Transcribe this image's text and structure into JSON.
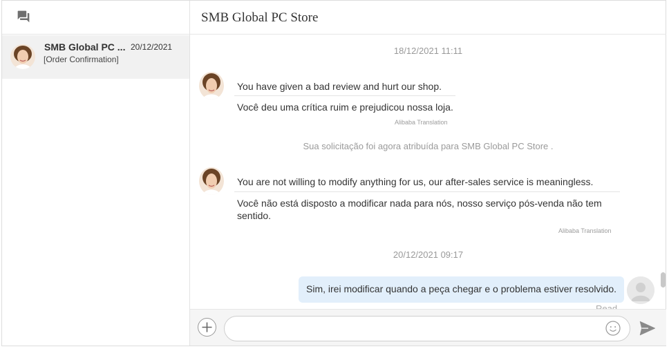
{
  "sidebar": {
    "conversations": [
      {
        "name": "SMB Global PC ...",
        "date": "20/12/2021",
        "preview": "[Order Confirmation]"
      }
    ]
  },
  "chat": {
    "title": "SMB Global PC Store",
    "timestamps": [
      "18/12/2021 11:11",
      "20/12/2021 09:17"
    ],
    "messages": [
      {
        "original": "You have given a bad review and hurt our shop.",
        "translated": "Você deu uma crítica ruim e prejudicou nossa loja.",
        "translation_tag": "Alibaba Translation"
      },
      {
        "original": "You are not willing to modify anything for us, our after-sales service is meaningless.",
        "translated_line1": "Você não está disposto a modificar nada para nós, nosso serviço pós-venda não tem",
        "translated_line2": "sentido.",
        "translation_tag": "Alibaba Translation"
      }
    ],
    "system_note": "Sua solicitação foi agora atribuída para SMB Global PC Store .",
    "my_message": "Sim, irei modificar quando a peça chegar e o problema estiver resolvido.",
    "read_status": "Read"
  },
  "composer": {
    "placeholder": ""
  },
  "colors": {
    "my_bubble": "#e2effb",
    "sidebar_selected": "#f1f1f1",
    "muted_text": "#999999"
  },
  "icons": {
    "header": "chat-bubbles-icon",
    "add": "plus-icon",
    "emoji": "smiley-icon",
    "send": "send-icon"
  }
}
